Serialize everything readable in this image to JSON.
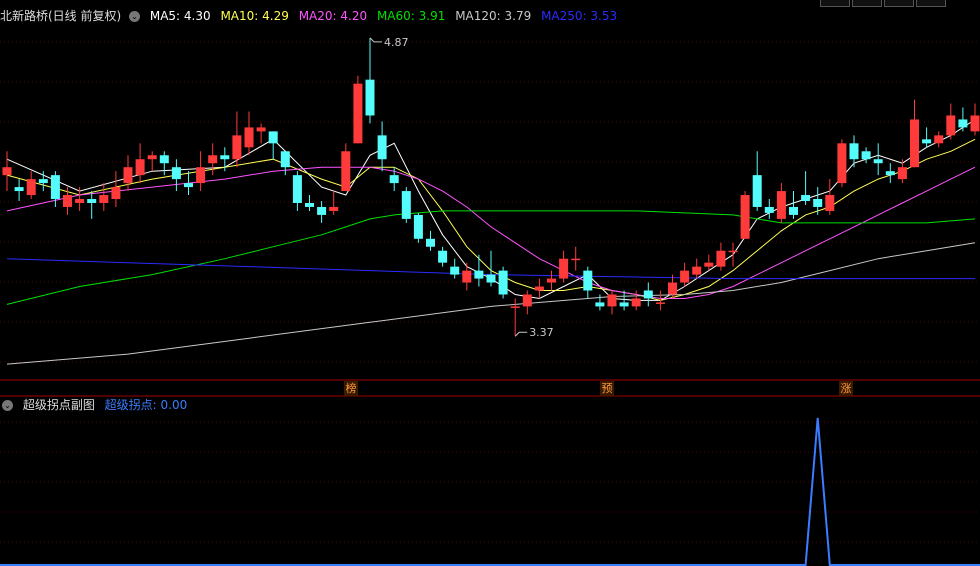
{
  "main_header": {
    "title": "北新路桥(日线 前复权)",
    "ma5": "MA5: 4.30",
    "ma10": "MA10: 4.29",
    "ma20": "MA20: 4.20",
    "ma60": "MA60: 3.91",
    "ma120": "MA120: 3.79",
    "ma250": "MA250: 3.53"
  },
  "sub_header": {
    "title": "超级拐点副图",
    "indicator": "超级拐点: 0.00"
  },
  "signals": [
    "榜",
    "预",
    "涨"
  ],
  "colors": {
    "up": "#ff3a3a",
    "down": "#54fcfc",
    "ma5": "#ffffff",
    "ma10": "#ffff54",
    "ma20": "#ff54ff",
    "ma60": "#00e000",
    "ma120": "#c8c8c8",
    "ma250": "#2b2bff",
    "indicator": "#3b7dff"
  },
  "chart_data": [
    {
      "type": "candlestick",
      "title": "北新路桥(日线 前复权)",
      "price_range": [
        3.15,
        4.95
      ],
      "annotations": [
        {
          "label": "4.87",
          "candle": 30,
          "value": 4.87
        },
        {
          "label": "3.37",
          "candle": 42,
          "value": 3.37
        }
      ],
      "ohlc": [
        [
          4.18,
          4.22,
          4.1,
          4.3
        ],
        [
          4.12,
          4.1,
          4.05,
          4.16
        ],
        [
          4.08,
          4.16,
          4.06,
          4.2
        ],
        [
          4.16,
          4.14,
          4.1,
          4.2
        ],
        [
          4.18,
          4.06,
          4.02,
          4.2
        ],
        [
          4.02,
          4.08,
          3.98,
          4.12
        ],
        [
          4.04,
          4.06,
          4.0,
          4.12
        ],
        [
          4.06,
          4.04,
          3.96,
          4.1
        ],
        [
          4.04,
          4.08,
          4.0,
          4.14
        ],
        [
          4.06,
          4.12,
          4.02,
          4.2
        ],
        [
          4.14,
          4.22,
          4.1,
          4.28
        ],
        [
          4.18,
          4.26,
          4.14,
          4.34
        ],
        [
          4.26,
          4.28,
          4.2,
          4.3
        ],
        [
          4.28,
          4.24,
          4.18,
          4.3
        ],
        [
          4.22,
          4.16,
          4.1,
          4.26
        ],
        [
          4.14,
          4.12,
          4.08,
          4.2
        ],
        [
          4.14,
          4.22,
          4.1,
          4.3
        ],
        [
          4.24,
          4.28,
          4.18,
          4.34
        ],
        [
          4.28,
          4.26,
          4.2,
          4.32
        ],
        [
          4.26,
          4.38,
          4.22,
          4.5
        ],
        [
          4.32,
          4.42,
          4.28,
          4.5
        ],
        [
          4.4,
          4.42,
          4.34,
          4.44
        ],
        [
          4.4,
          4.34,
          4.26,
          4.4
        ],
        [
          4.3,
          4.22,
          4.18,
          4.28
        ],
        [
          4.18,
          4.04,
          4.0,
          4.2
        ],
        [
          4.04,
          4.02,
          4.0,
          4.08
        ],
        [
          4.02,
          3.98,
          3.94,
          4.05
        ],
        [
          4.0,
          4.02,
          3.98,
          4.1
        ],
        [
          4.1,
          4.3,
          4.1,
          4.34
        ],
        [
          4.34,
          4.64,
          4.34,
          4.68
        ],
        [
          4.66,
          4.48,
          4.44,
          4.87
        ],
        [
          4.38,
          4.26,
          4.2,
          4.45
        ],
        [
          4.18,
          4.14,
          4.1,
          4.22
        ],
        [
          4.1,
          3.96,
          3.94,
          4.12
        ],
        [
          3.98,
          3.86,
          3.84,
          3.99
        ],
        [
          3.86,
          3.82,
          3.8,
          3.9
        ],
        [
          3.8,
          3.74,
          3.72,
          3.82
        ],
        [
          3.72,
          3.68,
          3.66,
          3.76
        ],
        [
          3.64,
          3.7,
          3.6,
          3.74
        ],
        [
          3.7,
          3.66,
          3.62,
          3.78
        ],
        [
          3.68,
          3.64,
          3.62,
          3.8
        ],
        [
          3.7,
          3.58,
          3.56,
          3.72
        ],
        [
          3.52,
          3.52,
          3.37,
          3.56
        ],
        [
          3.52,
          3.58,
          3.48,
          3.6
        ],
        [
          3.6,
          3.62,
          3.56,
          3.66
        ],
        [
          3.64,
          3.66,
          3.6,
          3.7
        ],
        [
          3.66,
          3.76,
          3.64,
          3.8
        ],
        [
          3.76,
          3.76,
          3.7,
          3.82
        ],
        [
          3.7,
          3.6,
          3.56,
          3.72
        ],
        [
          3.54,
          3.52,
          3.5,
          3.58
        ],
        [
          3.52,
          3.58,
          3.48,
          3.6
        ],
        [
          3.54,
          3.52,
          3.5,
          3.6
        ],
        [
          3.52,
          3.56,
          3.5,
          3.6
        ],
        [
          3.6,
          3.56,
          3.52,
          3.64
        ],
        [
          3.54,
          3.54,
          3.5,
          3.6
        ],
        [
          3.58,
          3.64,
          3.56,
          3.68
        ],
        [
          3.64,
          3.7,
          3.62,
          3.74
        ],
        [
          3.68,
          3.72,
          3.66,
          3.76
        ],
        [
          3.72,
          3.74,
          3.7,
          3.78
        ],
        [
          3.72,
          3.8,
          3.7,
          3.84
        ],
        [
          3.8,
          3.8,
          3.72,
          3.84
        ],
        [
          3.86,
          4.08,
          3.86,
          4.1
        ],
        [
          4.18,
          4.02,
          4.0,
          4.3
        ],
        [
          4.02,
          3.99,
          3.96,
          4.06
        ],
        [
          3.96,
          4.1,
          3.94,
          4.14
        ],
        [
          4.02,
          3.98,
          3.96,
          4.1
        ],
        [
          4.08,
          4.05,
          4.03,
          4.2
        ],
        [
          4.06,
          4.02,
          3.98,
          4.12
        ],
        [
          4.0,
          4.08,
          3.98,
          4.16
        ],
        [
          4.14,
          4.34,
          4.12,
          4.36
        ],
        [
          4.34,
          4.26,
          4.22,
          4.38
        ],
        [
          4.3,
          4.26,
          4.24,
          4.32
        ],
        [
          4.26,
          4.24,
          4.18,
          4.34
        ],
        [
          4.2,
          4.18,
          4.14,
          4.24
        ],
        [
          4.16,
          4.22,
          4.14,
          4.26
        ],
        [
          4.22,
          4.46,
          4.22,
          4.56
        ],
        [
          4.36,
          4.34,
          4.32,
          4.42
        ],
        [
          4.34,
          4.38,
          4.32,
          4.4
        ],
        [
          4.38,
          4.48,
          4.36,
          4.54
        ],
        [
          4.46,
          4.42,
          4.4,
          4.52
        ],
        [
          4.4,
          4.48,
          4.38,
          4.54
        ]
      ],
      "ma_lines": [
        {
          "name": "MA5",
          "color": "#ffffff",
          "values": [
            [
              0,
              4.26
            ],
            [
              6,
              4.1
            ],
            [
              12,
              4.2
            ],
            [
              18,
              4.22
            ],
            [
              22,
              4.36
            ],
            [
              26,
              4.12
            ],
            [
              28,
              4.08
            ],
            [
              30,
              4.28
            ],
            [
              32,
              4.34
            ],
            [
              34,
              4.1
            ],
            [
              36,
              3.88
            ],
            [
              38,
              3.72
            ],
            [
              40,
              3.66
            ],
            [
              42,
              3.58
            ],
            [
              44,
              3.56
            ],
            [
              46,
              3.62
            ],
            [
              48,
              3.68
            ],
            [
              50,
              3.56
            ],
            [
              52,
              3.55
            ],
            [
              54,
              3.55
            ],
            [
              56,
              3.62
            ],
            [
              58,
              3.7
            ],
            [
              60,
              3.78
            ],
            [
              62,
              3.96
            ],
            [
              64,
              4.02
            ],
            [
              66,
              4.06
            ],
            [
              68,
              4.1
            ],
            [
              70,
              4.24
            ],
            [
              72,
              4.28
            ],
            [
              74,
              4.24
            ],
            [
              76,
              4.32
            ],
            [
              78,
              4.38
            ],
            [
              80,
              4.46
            ]
          ]
        },
        {
          "name": "MA10",
          "color": "#ffff54",
          "values": [
            [
              0,
              4.18
            ],
            [
              6,
              4.08
            ],
            [
              12,
              4.16
            ],
            [
              18,
              4.22
            ],
            [
              22,
              4.26
            ],
            [
              26,
              4.16
            ],
            [
              28,
              4.12
            ],
            [
              30,
              4.22
            ],
            [
              32,
              4.22
            ],
            [
              34,
              4.16
            ],
            [
              36,
              4.0
            ],
            [
              38,
              3.82
            ],
            [
              40,
              3.7
            ],
            [
              42,
              3.64
            ],
            [
              44,
              3.6
            ],
            [
              46,
              3.6
            ],
            [
              48,
              3.62
            ],
            [
              50,
              3.6
            ],
            [
              52,
              3.58
            ],
            [
              54,
              3.55
            ],
            [
              56,
              3.58
            ],
            [
              58,
              3.62
            ],
            [
              60,
              3.7
            ],
            [
              62,
              3.8
            ],
            [
              64,
              3.9
            ],
            [
              66,
              3.98
            ],
            [
              68,
              4.02
            ],
            [
              70,
              4.1
            ],
            [
              72,
              4.16
            ],
            [
              74,
              4.2
            ],
            [
              76,
              4.26
            ],
            [
              78,
              4.3
            ],
            [
              80,
              4.36
            ]
          ]
        },
        {
          "name": "MA20",
          "color": "#ff54ff",
          "values": [
            [
              0,
              4.0
            ],
            [
              6,
              4.08
            ],
            [
              12,
              4.12
            ],
            [
              18,
              4.16
            ],
            [
              22,
              4.2
            ],
            [
              26,
              4.22
            ],
            [
              28,
              4.22
            ],
            [
              30,
              4.22
            ],
            [
              32,
              4.2
            ],
            [
              34,
              4.16
            ],
            [
              36,
              4.1
            ],
            [
              38,
              4.02
            ],
            [
              40,
              3.92
            ],
            [
              42,
              3.84
            ],
            [
              44,
              3.76
            ],
            [
              46,
              3.7
            ],
            [
              48,
              3.64
            ],
            [
              50,
              3.6
            ],
            [
              52,
              3.58
            ],
            [
              54,
              3.56
            ],
            [
              56,
              3.56
            ],
            [
              58,
              3.58
            ],
            [
              60,
              3.62
            ],
            [
              62,
              3.68
            ],
            [
              64,
              3.74
            ],
            [
              66,
              3.8
            ],
            [
              68,
              3.86
            ],
            [
              70,
              3.92
            ],
            [
              72,
              3.98
            ],
            [
              74,
              4.04
            ],
            [
              76,
              4.1
            ],
            [
              78,
              4.16
            ],
            [
              80,
              4.22
            ]
          ]
        },
        {
          "name": "MA60",
          "color": "#00e000",
          "values": [
            [
              0,
              3.53
            ],
            [
              6,
              3.62
            ],
            [
              12,
              3.68
            ],
            [
              18,
              3.76
            ],
            [
              22,
              3.82
            ],
            [
              26,
              3.88
            ],
            [
              28,
              3.92
            ],
            [
              30,
              3.96
            ],
            [
              32,
              3.98
            ],
            [
              34,
              3.99
            ],
            [
              36,
              4.0
            ],
            [
              40,
              4.0
            ],
            [
              44,
              4.0
            ],
            [
              48,
              4.0
            ],
            [
              52,
              4.0
            ],
            [
              56,
              3.99
            ],
            [
              60,
              3.98
            ],
            [
              62,
              3.96
            ],
            [
              64,
              3.94
            ],
            [
              66,
              3.94
            ],
            [
              68,
              3.94
            ],
            [
              72,
              3.94
            ],
            [
              76,
              3.94
            ],
            [
              80,
              3.96
            ]
          ]
        },
        {
          "name": "MA120",
          "color": "#c8c8c8",
          "values": [
            [
              0,
              3.23
            ],
            [
              10,
              3.28
            ],
            [
              20,
              3.36
            ],
            [
              30,
              3.44
            ],
            [
              40,
              3.52
            ],
            [
              50,
              3.57
            ],
            [
              56,
              3.58
            ],
            [
              60,
              3.6
            ],
            [
              64,
              3.64
            ],
            [
              68,
              3.7
            ],
            [
              72,
              3.76
            ],
            [
              76,
              3.8
            ],
            [
              80,
              3.84
            ]
          ]
        },
        {
          "name": "MA250",
          "color": "#2b2bff",
          "values": [
            [
              0,
              3.76
            ],
            [
              10,
              3.74
            ],
            [
              20,
              3.72
            ],
            [
              30,
              3.7
            ],
            [
              40,
              3.68
            ],
            [
              50,
              3.67
            ],
            [
              60,
              3.66
            ],
            [
              70,
              3.66
            ],
            [
              80,
              3.66
            ]
          ]
        }
      ]
    },
    {
      "type": "line",
      "title": "超级拐点副图",
      "series": [
        {
          "name": "超级拐点",
          "values": [
            0,
            0,
            1,
            0,
            0
          ]
        }
      ],
      "x": [
        0,
        66,
        67,
        68,
        80
      ],
      "ylim": [
        0,
        1
      ]
    }
  ]
}
